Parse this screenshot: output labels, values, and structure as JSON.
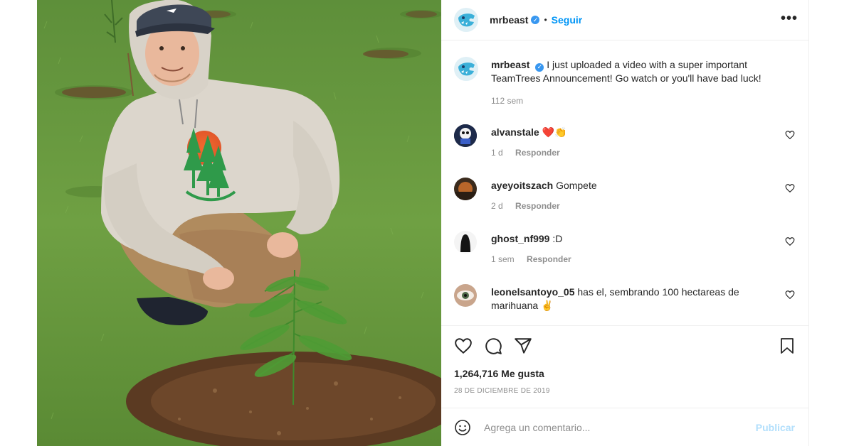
{
  "colors": {
    "accent": "#0095f6",
    "publish_disabled": "#b2dffc",
    "muted": "#8e8e8e",
    "verified": "#3897f0"
  },
  "post": {
    "image_alt_icon": "photo-of-man-planting-tree"
  },
  "header": {
    "username": "mrbeast",
    "separator": "•",
    "follow_label": "Seguir",
    "more_label": "•••"
  },
  "caption": {
    "username": "mrbeast",
    "text": "I just uploaded a video with a super important TeamTrees Announcement! Go watch or you'll have bad luck!",
    "time": "112 sem"
  },
  "comments": [
    {
      "username": "alvanstale",
      "text": "❤️👏",
      "time": "1 d",
      "reply_label": "Responder"
    },
    {
      "username": "ayeyoitszach",
      "text": "Gompete",
      "time": "2 d",
      "reply_label": "Responder"
    },
    {
      "username": "ghost_nf999",
      "text": ":D",
      "time": "1 sem",
      "reply_label": "Responder"
    },
    {
      "username": "leonelsantoyo_05",
      "text": "has el, sembrando 100 hectareas de marihuana ✌️",
      "time": "",
      "reply_label": ""
    }
  ],
  "actions": {
    "likes": "1,264,716 Me gusta",
    "date": "28 DE DICIEMBRE DE 2019"
  },
  "comment_box": {
    "placeholder": "Agrega un comentario...",
    "publish_label": "Publicar"
  }
}
